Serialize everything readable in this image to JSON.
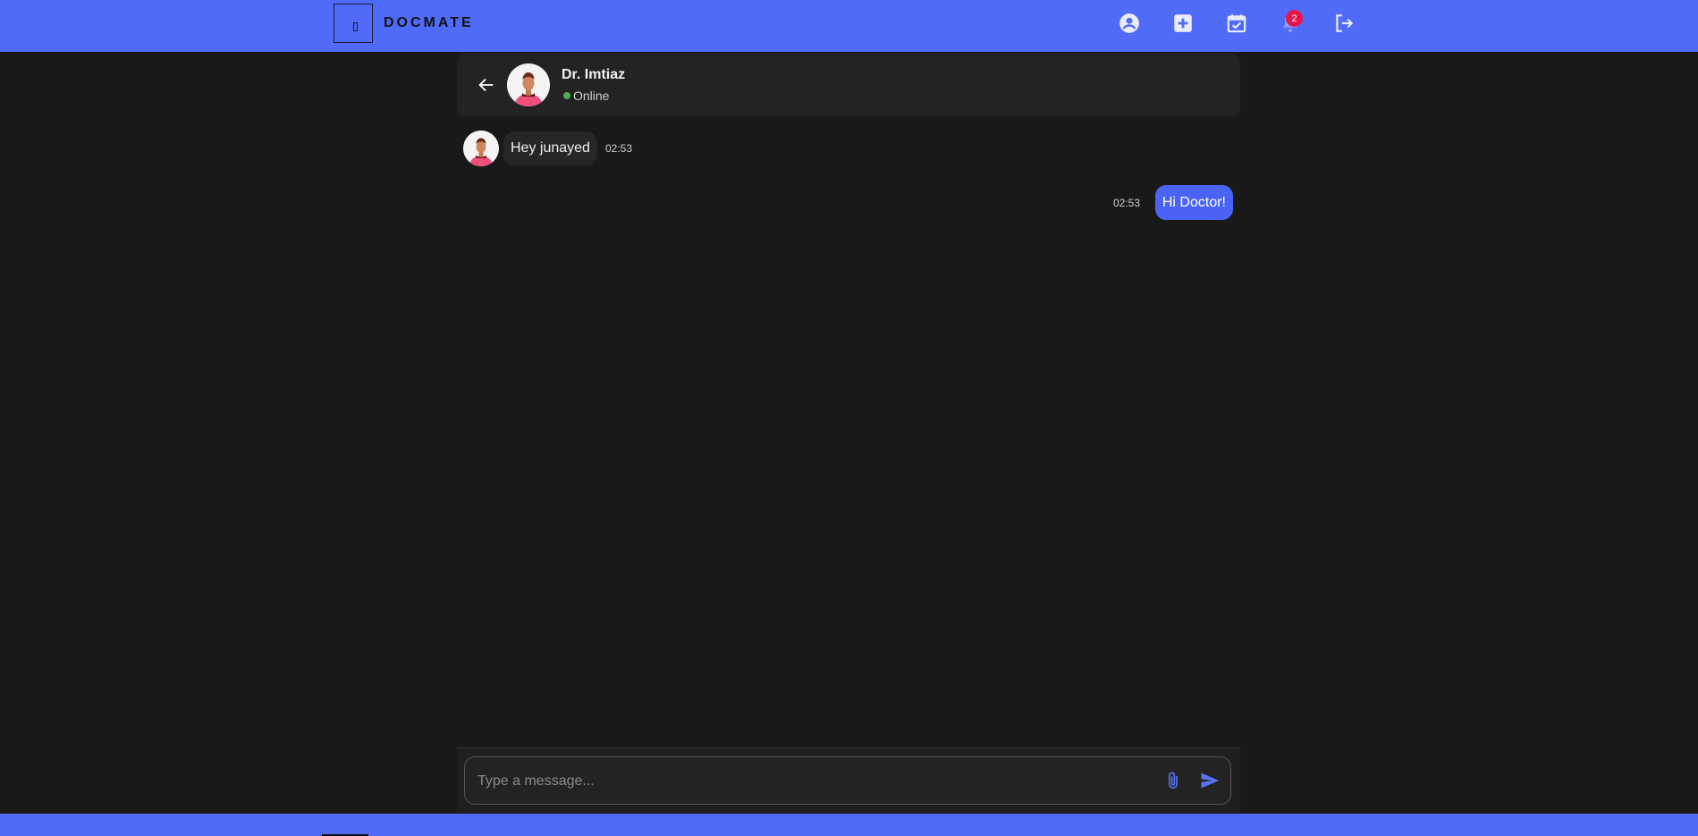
{
  "brand": {
    "name": "DOCMATE"
  },
  "nav": {
    "icons": [
      "account-circle-icon",
      "medical-plus-icon",
      "calendar-check-icon",
      "bell-icon",
      "logout-icon"
    ],
    "notification_count": "2",
    "accent_color": "#4f6bf7"
  },
  "chat": {
    "contact_name": "Dr. Imtiaz",
    "status": "Online",
    "messages": [
      {
        "direction": "in",
        "text": "Hey junayed",
        "time": "02:53"
      },
      {
        "direction": "out",
        "text": "Hi Doctor!",
        "time": "02:53"
      }
    ]
  },
  "composer": {
    "placeholder": "Type a message..."
  }
}
